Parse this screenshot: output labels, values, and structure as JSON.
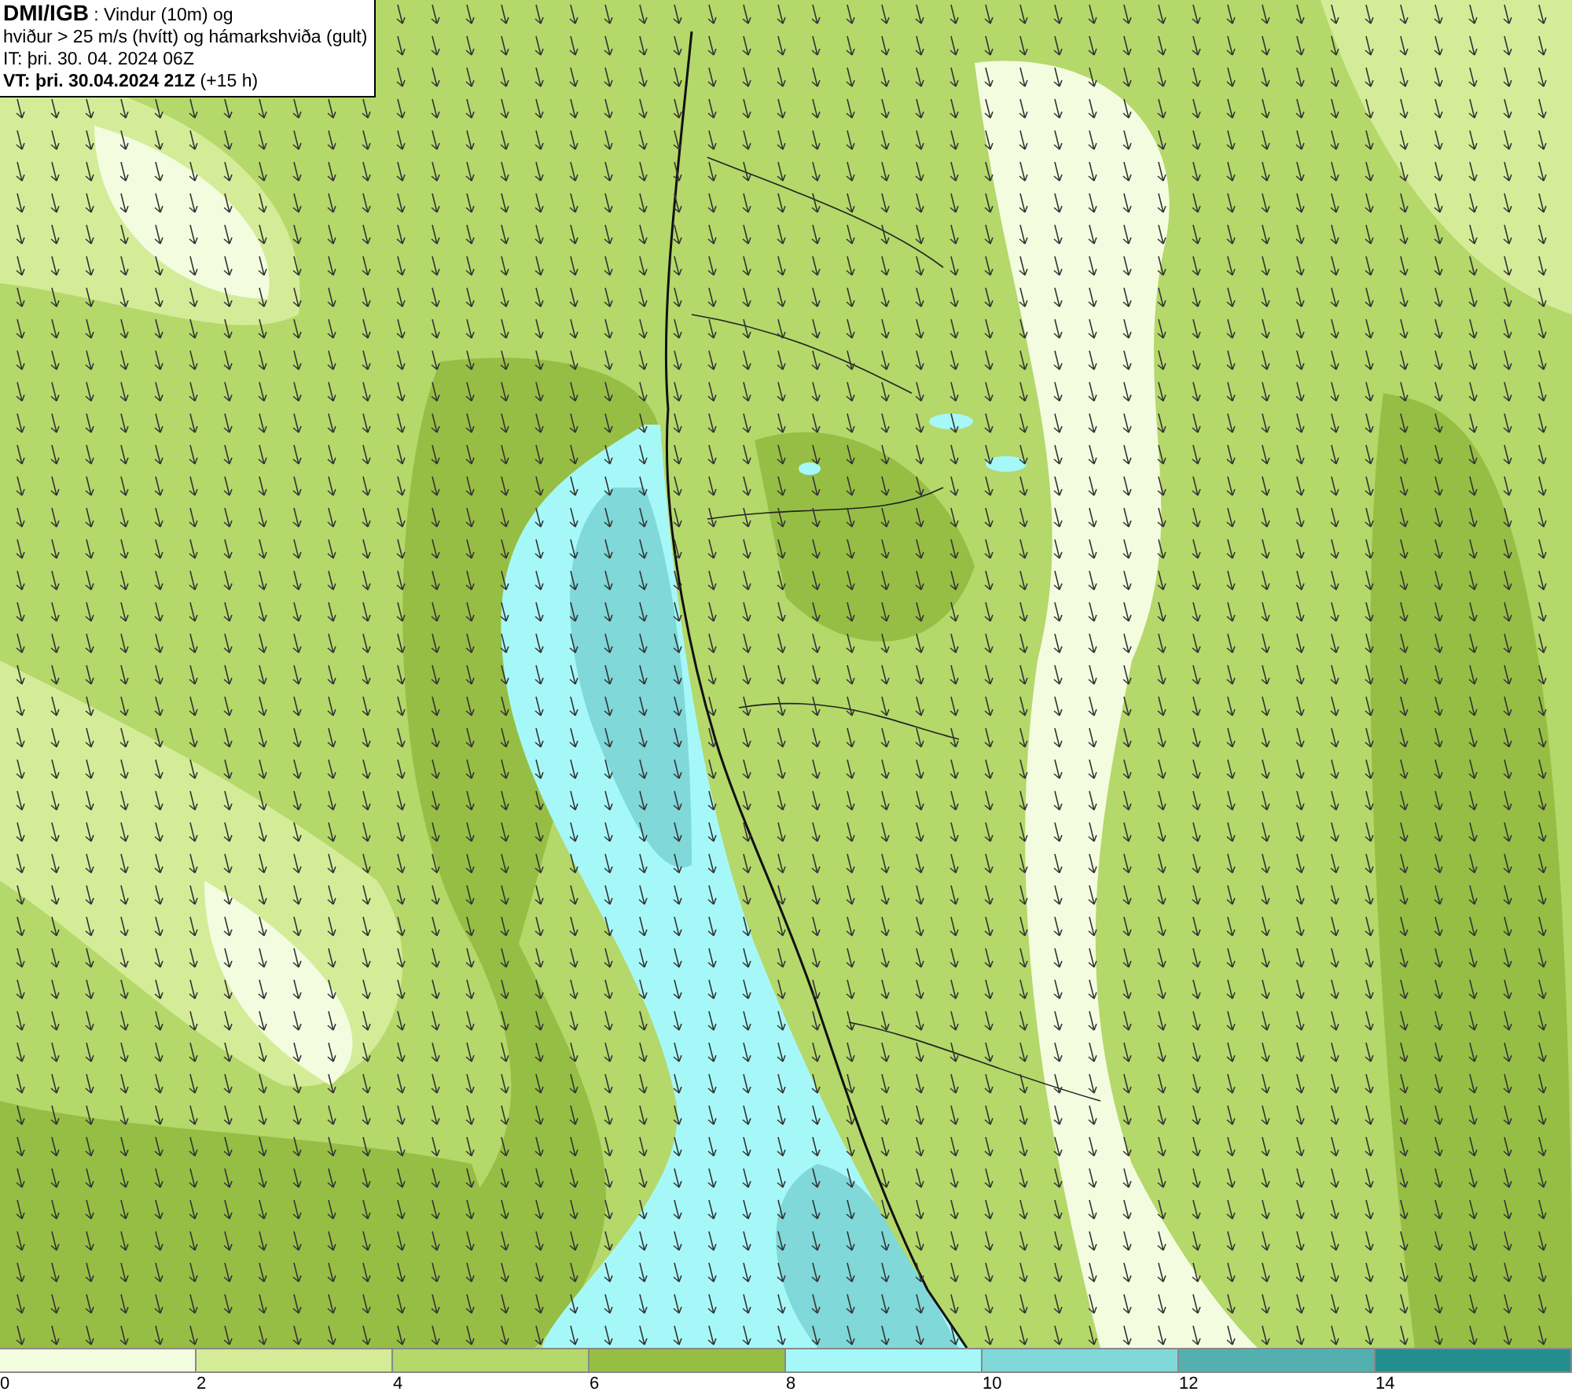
{
  "header": {
    "lines": [
      "**DMI/IGB** : Vindur (10m) og",
      "hviður > 25 m/s (hvítt) og hámarkshviða (gult)",
      "IT: þri. 30. 04. 2024 06Z",
      "**VT: þri. 30.04.2024 21Z** (+15 h)"
    ]
  },
  "legend": {
    "bins": [
      {
        "color": "#f4fce0"
      },
      {
        "color": "#d4ec98"
      },
      {
        "color": "#b4d86a"
      },
      {
        "color": "#96be44"
      },
      {
        "color": "#a6f8f8"
      },
      {
        "color": "#80d8d8"
      },
      {
        "color": "#54b0b0"
      },
      {
        "color": "#248e8e"
      }
    ],
    "ticks": [
      "0",
      "2",
      "4",
      "6",
      "8",
      "10",
      "12",
      "14"
    ]
  }
}
